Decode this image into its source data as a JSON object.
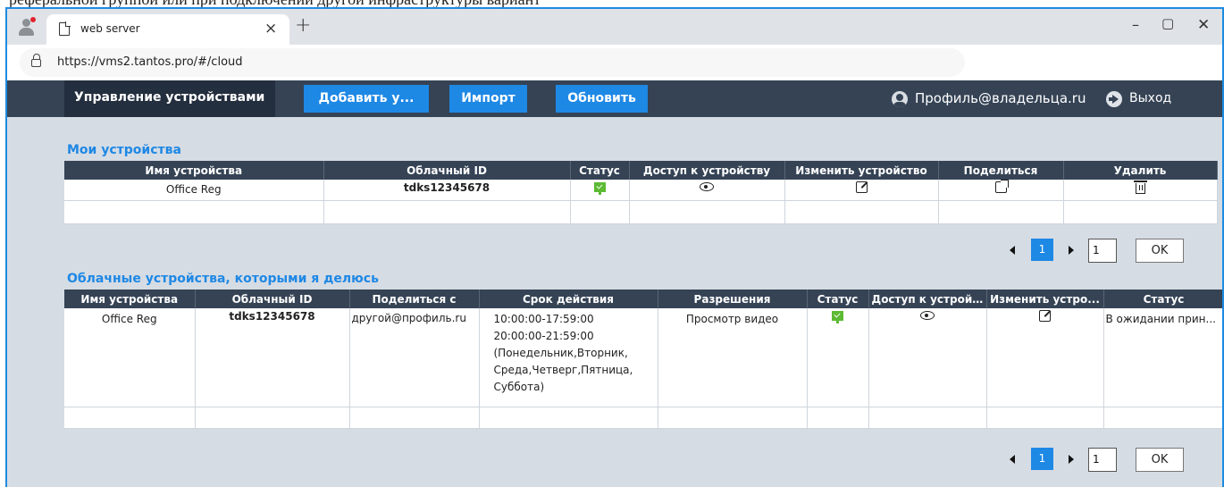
{
  "page_top_text": "реферальной группой или при подключении другой инфраструктуры вариант",
  "browser": {
    "tab_title": "web server",
    "url": "https://vms2.tantos.pro/#/cloud"
  },
  "header": {
    "manage_label": "Управление устройствами",
    "add_label": "Добавить у...",
    "import_label": "Импорт",
    "refresh_label": "Обновить",
    "profile_label": "Профиль@владельца.ru",
    "logout_label": "Выход"
  },
  "my_devices": {
    "title": "Мои устройства",
    "columns": [
      "Имя устройства",
      "Облачный ID",
      "Статус",
      "Доступ к устройству",
      "Изменить устройство",
      "Поделиться",
      "Удалить"
    ],
    "rows": [
      {
        "name": "Office Reg",
        "cloud_id": "tdks12345678",
        "status_icon": "online-monitor-icon",
        "access_icon": "eye-icon",
        "edit_icon": "edit-icon",
        "share_icon": "share-icon",
        "delete_icon": "trash-icon"
      }
    ],
    "pager": {
      "page": "1",
      "page_input": "1",
      "ok_label": "OK"
    }
  },
  "shared_devices": {
    "title": "Облачные устройства, которыми я делюсь",
    "columns": [
      "Имя устройства",
      "Облачный ID",
      "Поделиться с",
      "Срок действия",
      "Разрешения",
      "Статус",
      "Доступ к устрой...",
      "Изменить устро...",
      "Статус"
    ],
    "rows": [
      {
        "name": "Office Reg",
        "cloud_id": "tdks12345678",
        "shared_with": "другой@профиль.ru",
        "validity_lines": [
          "10:00:00-17:59:00",
          "20:00:00-21:59:00",
          "(Понедельник,Вторник,",
          "Среда,Четверг,Пятница,",
          "Суббота)"
        ],
        "permissions": "Просмотр видео",
        "share_status": "В ожидании прин..."
      }
    ],
    "pager": {
      "page": "1",
      "page_input": "1",
      "ok_label": "OK"
    }
  },
  "colors": {
    "accent": "#1e88e5",
    "header_bg": "#354355",
    "active_tab_bg": "#232e3e",
    "app_bg": "#d6dce4",
    "status_green": "#5cba33",
    "window_border": "#1e8be0"
  }
}
